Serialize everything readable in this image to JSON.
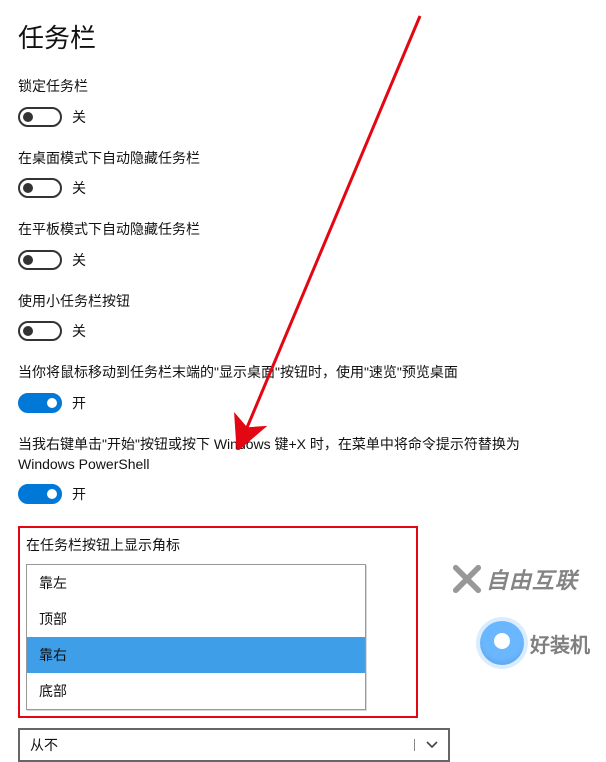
{
  "page_title": "任务栏",
  "settings": [
    {
      "label": "锁定任务栏",
      "on": false,
      "state": "关"
    },
    {
      "label": "在桌面模式下自动隐藏任务栏",
      "on": false,
      "state": "关"
    },
    {
      "label": "在平板模式下自动隐藏任务栏",
      "on": false,
      "state": "关"
    },
    {
      "label": "使用小任务栏按钮",
      "on": false,
      "state": "关"
    },
    {
      "label": "当你将鼠标移动到任务栏末端的\"显示桌面\"按钮时，使用\"速览\"预览桌面",
      "on": true,
      "state": "开"
    },
    {
      "label": "当我右键单击\"开始\"按钮或按下 Windows 键+X 时，在菜单中将命令提示符替换为 Windows PowerShell",
      "on": true,
      "state": "开"
    }
  ],
  "badge_section": {
    "label": "在任务栏按钮上显示角标",
    "options": [
      "靠左",
      "顶部",
      "靠右",
      "底部"
    ],
    "selected_index": 2
  },
  "combine_section": {
    "value": "从不"
  },
  "watermark1": "自由互联",
  "watermark2": "好装机",
  "annotation_color": "#e30613"
}
